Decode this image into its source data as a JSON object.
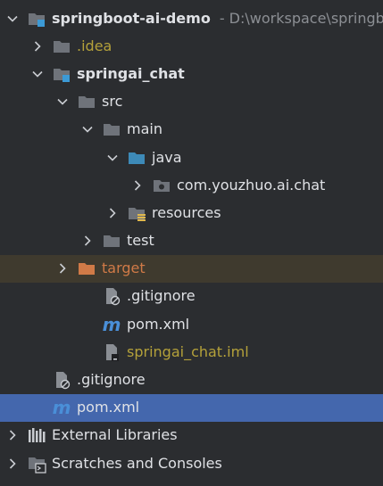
{
  "tree": {
    "project_root": {
      "label": "springboot-ai-demo",
      "path": "- D:\\workspace\\springboot-ai-demo"
    },
    "idea": {
      "label": ".idea"
    },
    "module": {
      "label": "springai_chat"
    },
    "src": {
      "label": "src"
    },
    "main": {
      "label": "main"
    },
    "java": {
      "label": "java"
    },
    "package": {
      "label": "com.youzhuo.ai.chat"
    },
    "resources": {
      "label": "resources"
    },
    "test": {
      "label": "test"
    },
    "target": {
      "label": "target"
    },
    "module_gitignore": {
      "label": ".gitignore"
    },
    "module_pom": {
      "label": "pom.xml"
    },
    "module_iml": {
      "label": "springai_chat.iml"
    },
    "root_gitignore": {
      "label": ".gitignore"
    },
    "root_pom": {
      "label": "pom.xml"
    },
    "external_libraries": {
      "label": "External Libraries"
    },
    "scratches": {
      "label": "Scratches and Consoles"
    }
  },
  "colors": {
    "background": "#2b2d30",
    "text": "#dfe1e5",
    "excluded_text": "#d07a47",
    "excluded_row": "#3f3a2e",
    "iml_text": "#b4a13a",
    "selection": "#4467ad",
    "folder": "#6f737a",
    "source_folder": "#3d8ab8"
  }
}
